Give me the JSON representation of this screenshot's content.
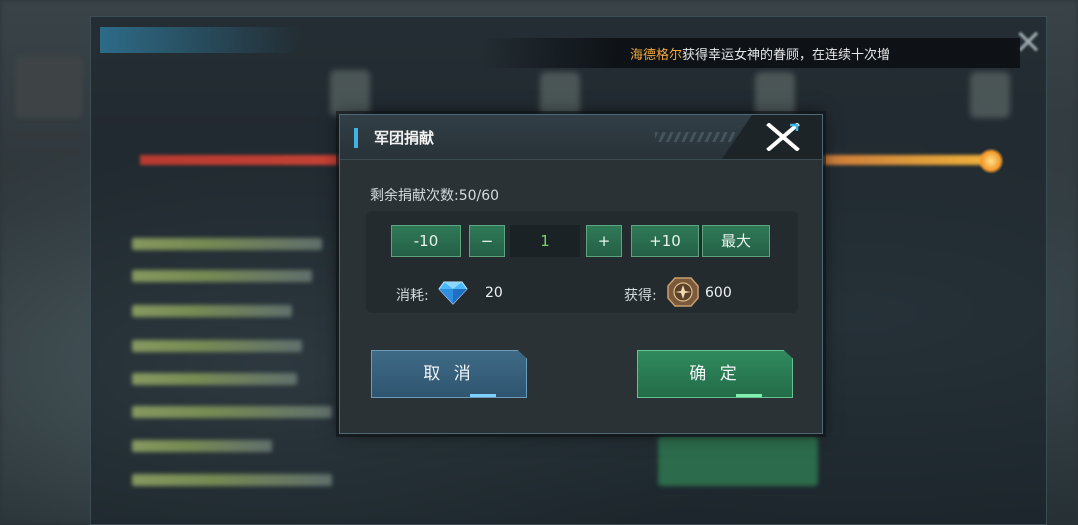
{
  "marquee": {
    "player_name": "海德格尔",
    "message": "获得幸运女神的眷顾，在连续十次增"
  },
  "dialog": {
    "title": "军团捐献",
    "remaining_label": "剩余捐献次数:50/60",
    "buttons": {
      "minus_ten": "-10",
      "minus_one": "−",
      "quantity": "1",
      "plus_one": "+",
      "plus_ten": "+10",
      "max": "最大"
    },
    "cost": {
      "label": "消耗:",
      "value": "20",
      "icon": "diamond-icon"
    },
    "gain": {
      "label": "获得:",
      "value": "600",
      "icon": "medal-icon"
    },
    "cancel_label": "取 消",
    "confirm_label": "确 定"
  },
  "colors": {
    "accent_blue": "#3fb2e6",
    "confirm_green": "#2f8a5d",
    "cancel_blue": "#3e6a86",
    "player_name_orange": "#f0a63a",
    "quantity_green": "#7ad36a"
  }
}
